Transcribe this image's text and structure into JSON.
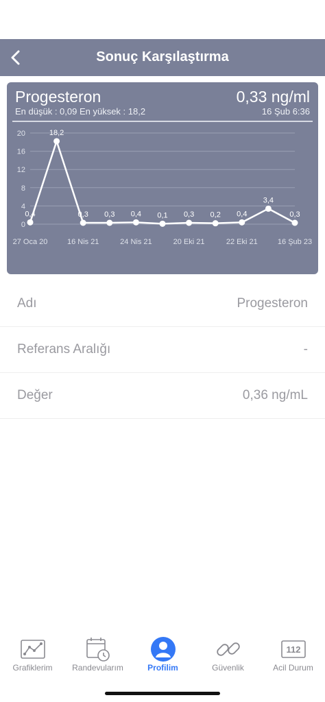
{
  "header": {
    "title": "Sonuç Karşılaştırma",
    "back_icon": "chevron-left-icon"
  },
  "summary": {
    "name": "Progesteron",
    "latest_value": "0,33 ng/ml",
    "range_text": "En düşük : 0,09 En yüksek : 18,2",
    "latest_date": "16 Şub 6:36"
  },
  "chart_data": {
    "type": "line",
    "series": [
      {
        "values": [
          0.4,
          18.2,
          0.3,
          0.3,
          0.4,
          0.1,
          0.3,
          0.2,
          0.4,
          3.4,
          0.3
        ]
      }
    ],
    "point_labels": [
      "0,4",
      "18,2",
      "0,3",
      "0,3",
      "0,4",
      "0,1",
      "0,3",
      "0,2",
      "0,4",
      "3,4",
      "0,3"
    ],
    "x_tick_labels": [
      "27 Oca 20",
      "16 Nis 21",
      "24 Nis 21",
      "20 Eki 21",
      "22 Eki 21",
      "16 Şub 23"
    ],
    "y_ticks": [
      0,
      4,
      8,
      12,
      16,
      20
    ],
    "ylim": [
      0,
      20
    ],
    "grid": true,
    "line_color": "#ffffff"
  },
  "details": [
    {
      "label": "Adı",
      "value": "Progesteron"
    },
    {
      "label": "Referans Aralığı",
      "value": "-"
    },
    {
      "label": "Değer",
      "value": "0,36 ng/mL"
    }
  ],
  "tabs": [
    {
      "label": "Grafiklerim",
      "icon": "line-chart-icon",
      "active": false
    },
    {
      "label": "Randevularım",
      "icon": "calendar-clock-icon",
      "active": false
    },
    {
      "label": "Profilim",
      "icon": "user-icon",
      "active": true
    },
    {
      "label": "Güvenlik",
      "icon": "link-icon",
      "active": false
    },
    {
      "label": "Acil Durum",
      "icon": "emergency-112-icon",
      "active": false
    }
  ],
  "colors": {
    "header_bg": "#7a8098",
    "active_tab": "#3478f6"
  }
}
